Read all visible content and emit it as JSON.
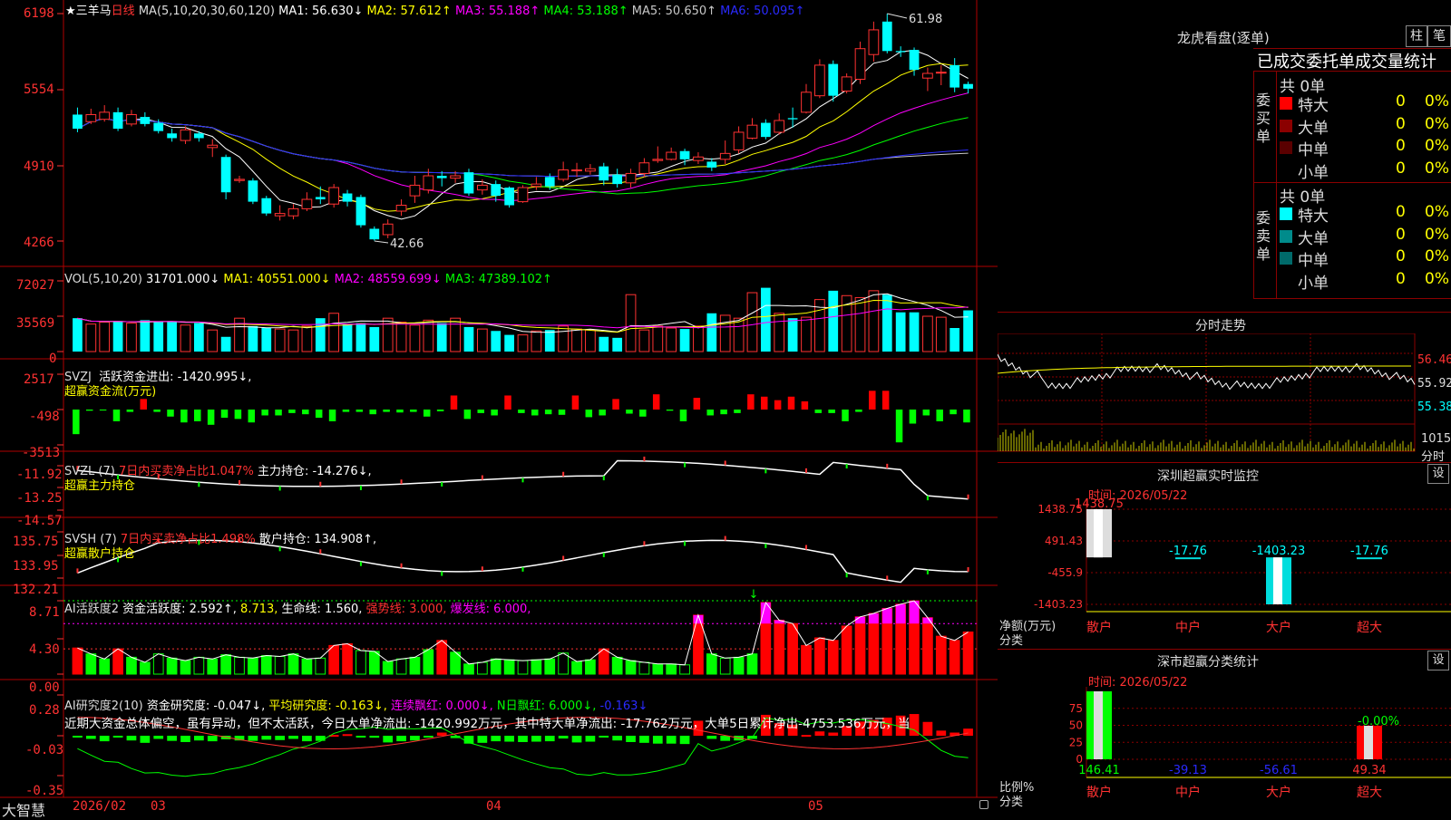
{
  "app_name": "大智慧",
  "kline": {
    "stock_name": "三羊马",
    "period": "日线",
    "ma_title": "MA(5,10,20,30,60,120)",
    "ma": [
      {
        "label": "MA1: 56.630↓",
        "color": "#ffffff"
      },
      {
        "label": "MA2: 57.612↑",
        "color": "#ffff00"
      },
      {
        "label": "MA3: 55.188↑",
        "color": "#ff00ff"
      },
      {
        "label": "MA4: 53.188↑",
        "color": "#00ff00"
      },
      {
        "label": "MA5: 50.650↑",
        "color": "#c8c8c8"
      },
      {
        "label": "MA6: 50.095↑",
        "color": "#2a2aff"
      }
    ],
    "y_ticks": [
      "6198",
      "5554",
      "4910",
      "4266"
    ],
    "high_label": "61.98",
    "low_label": "42.66",
    "candles": [
      {
        "o": 53.4,
        "c": 52.2,
        "h": 54.0,
        "l": 51.9
      },
      {
        "o": 52.8,
        "c": 53.4,
        "h": 53.9,
        "l": 52.6
      },
      {
        "o": 53.0,
        "c": 53.6,
        "h": 54.2,
        "l": 52.8
      },
      {
        "o": 53.6,
        "c": 52.2,
        "h": 54.0,
        "l": 52.0
      },
      {
        "o": 52.6,
        "c": 53.4,
        "h": 53.8,
        "l": 52.4
      },
      {
        "o": 53.2,
        "c": 52.6,
        "h": 53.6,
        "l": 52.4
      },
      {
        "o": 52.7,
        "c": 52.0,
        "h": 53.0,
        "l": 51.8
      },
      {
        "o": 51.8,
        "c": 51.4,
        "h": 52.2,
        "l": 51.1
      },
      {
        "o": 51.2,
        "c": 52.1,
        "h": 52.4,
        "l": 50.9
      },
      {
        "o": 51.8,
        "c": 51.4,
        "h": 52.0,
        "l": 51.1
      },
      {
        "o": 50.6,
        "c": 50.8,
        "h": 51.3,
        "l": 49.8
      },
      {
        "o": 49.8,
        "c": 46.8,
        "h": 50.0,
        "l": 46.2
      },
      {
        "o": 47.8,
        "c": 47.9,
        "h": 48.2,
        "l": 47.6
      },
      {
        "o": 47.8,
        "c": 46.0,
        "h": 48.0,
        "l": 45.8
      },
      {
        "o": 46.3,
        "c": 45.0,
        "h": 46.5,
        "l": 44.8
      },
      {
        "o": 44.8,
        "c": 45.0,
        "h": 45.7,
        "l": 44.4
      },
      {
        "o": 44.8,
        "c": 45.4,
        "h": 45.8,
        "l": 44.5
      },
      {
        "o": 45.4,
        "c": 46.2,
        "h": 46.8,
        "l": 45.2
      },
      {
        "o": 46.4,
        "c": 46.2,
        "h": 47.3,
        "l": 45.8
      },
      {
        "o": 45.8,
        "c": 47.2,
        "h": 47.5,
        "l": 45.5
      },
      {
        "o": 46.7,
        "c": 46.0,
        "h": 47.0,
        "l": 45.6
      },
      {
        "o": 46.4,
        "c": 44.0,
        "h": 46.6,
        "l": 43.8
      },
      {
        "o": 43.7,
        "c": 42.8,
        "h": 43.9,
        "l": 42.7
      },
      {
        "o": 43.2,
        "c": 44.1,
        "h": 44.5,
        "l": 42.9
      },
      {
        "o": 45.2,
        "c": 45.7,
        "h": 46.2,
        "l": 44.8
      },
      {
        "o": 46.5,
        "c": 47.4,
        "h": 48.2,
        "l": 45.9
      },
      {
        "o": 47.0,
        "c": 48.2,
        "h": 48.8,
        "l": 46.7
      },
      {
        "o": 48.2,
        "c": 48.0,
        "h": 48.6,
        "l": 47.3
      },
      {
        "o": 48.0,
        "c": 48.2,
        "h": 48.6,
        "l": 47.6
      },
      {
        "o": 48.5,
        "c": 46.7,
        "h": 48.8,
        "l": 46.5
      },
      {
        "o": 47.0,
        "c": 47.4,
        "h": 47.9,
        "l": 46.6
      },
      {
        "o": 47.5,
        "c": 46.5,
        "h": 47.8,
        "l": 46.0
      },
      {
        "o": 47.2,
        "c": 45.7,
        "h": 47.3,
        "l": 45.5
      },
      {
        "o": 46.0,
        "c": 47.2,
        "h": 47.4,
        "l": 45.9
      },
      {
        "o": 47.3,
        "c": 47.5,
        "h": 48.1,
        "l": 47.0
      },
      {
        "o": 48.1,
        "c": 47.3,
        "h": 48.4,
        "l": 47.0
      },
      {
        "o": 47.9,
        "c": 48.7,
        "h": 49.4,
        "l": 47.7
      },
      {
        "o": 48.7,
        "c": 48.7,
        "h": 49.3,
        "l": 48.1
      },
      {
        "o": 48.6,
        "c": 48.8,
        "h": 49.2,
        "l": 48.3
      },
      {
        "o": 49.0,
        "c": 47.8,
        "h": 49.3,
        "l": 47.4
      },
      {
        "o": 48.3,
        "c": 47.5,
        "h": 48.8,
        "l": 47.2
      },
      {
        "o": 47.6,
        "c": 48.4,
        "h": 48.8,
        "l": 47.2
      },
      {
        "o": 48.4,
        "c": 49.3,
        "h": 49.7,
        "l": 48.1
      },
      {
        "o": 49.5,
        "c": 49.6,
        "h": 50.7,
        "l": 49.3
      },
      {
        "o": 49.6,
        "c": 50.2,
        "h": 50.6,
        "l": 49.5
      },
      {
        "o": 50.3,
        "c": 49.6,
        "h": 50.5,
        "l": 49.1
      },
      {
        "o": 49.5,
        "c": 49.8,
        "h": 50.2,
        "l": 49.2
      },
      {
        "o": 49.4,
        "c": 48.9,
        "h": 49.7,
        "l": 48.6
      },
      {
        "o": 49.6,
        "c": 50.1,
        "h": 51.2,
        "l": 49.2
      },
      {
        "o": 50.4,
        "c": 51.9,
        "h": 52.4,
        "l": 50.1
      },
      {
        "o": 51.4,
        "c": 52.5,
        "h": 53.1,
        "l": 51.3
      },
      {
        "o": 52.7,
        "c": 51.5,
        "h": 53.0,
        "l": 51.3
      },
      {
        "o": 51.9,
        "c": 52.9,
        "h": 53.5,
        "l": 51.7
      },
      {
        "o": 53.1,
        "c": 53.0,
        "h": 54.0,
        "l": 52.3
      },
      {
        "o": 53.6,
        "c": 55.3,
        "h": 56.0,
        "l": 53.5
      },
      {
        "o": 55.0,
        "c": 57.6,
        "h": 58.1,
        "l": 54.8
      },
      {
        "o": 57.7,
        "c": 55.0,
        "h": 58.0,
        "l": 54.5
      },
      {
        "o": 55.4,
        "c": 56.6,
        "h": 56.9,
        "l": 55.2
      },
      {
        "o": 56.4,
        "c": 59.0,
        "h": 59.6,
        "l": 56.0
      },
      {
        "o": 58.5,
        "c": 60.6,
        "h": 61.3,
        "l": 57.9
      },
      {
        "o": 61.3,
        "c": 58.8,
        "h": 61.98,
        "l": 58.6
      },
      {
        "o": 58.8,
        "c": 58.7,
        "h": 59.2,
        "l": 58.3
      },
      {
        "o": 58.9,
        "c": 57.2,
        "h": 59.1,
        "l": 56.7
      },
      {
        "o": 56.5,
        "c": 56.9,
        "h": 57.4,
        "l": 55.4
      },
      {
        "o": 57.0,
        "c": 57.0,
        "h": 57.6,
        "l": 55.9
      },
      {
        "o": 57.6,
        "c": 55.7,
        "h": 58.2,
        "l": 55.3
      },
      {
        "o": 56.0,
        "c": 55.6,
        "h": 56.2,
        "l": 55.2
      }
    ]
  },
  "vol": {
    "title": "VOL(5,10,20)",
    "value": "31701.000↓",
    "ma1": "MA1: 40551.000↓",
    "ma2": "MA2: 48559.699↓",
    "ma3": "MA3: 47389.102↑",
    "y_ticks": [
      "72027",
      "35569",
      "0"
    ],
    "values": [
      34000,
      28000,
      30000,
      31000,
      29000,
      32000,
      30000,
      31000,
      27000,
      29000,
      22000,
      15000,
      34000,
      26000,
      24000,
      23000,
      22000,
      26000,
      34000,
      39000,
      28000,
      29000,
      25000,
      34000,
      30000,
      27000,
      32000,
      29000,
      34000,
      25000,
      23000,
      21000,
      17000,
      17000,
      21000,
      22000,
      26000,
      23000,
      22000,
      15000,
      14000,
      58000,
      22000,
      26000,
      24000,
      23000,
      26000,
      39000,
      37000,
      34000,
      60000,
      65000,
      39000,
      34000,
      35000,
      53000,
      62000,
      57000,
      55000,
      62000,
      58000,
      40000,
      40000,
      36000,
      35000,
      24000,
      42000
    ]
  },
  "svzj": {
    "title": "SVZJ",
    "value_label": "活跃资金进出: -1420.995↓,",
    "subtitle": "超赢资金流(万元)",
    "y_ticks": [
      "2517",
      "-498",
      "-3513"
    ],
    "values": [
      -2100,
      -100,
      -80,
      -1000,
      -200,
      900,
      -200,
      -600,
      -1100,
      -1000,
      -1300,
      -700,
      -800,
      -1100,
      -500,
      -500,
      -300,
      -400,
      -700,
      -1000,
      -200,
      -200,
      -400,
      -200,
      -250,
      -200,
      -600,
      -150,
      1200,
      -800,
      -300,
      -500,
      1200,
      -300,
      -500,
      -400,
      -450,
      1200,
      -650,
      -500,
      900,
      -350,
      -600,
      1300,
      -100,
      -1000,
      1000,
      -500,
      -400,
      -300,
      1300,
      1100,
      800,
      1100,
      700,
      -300,
      -300,
      -1000,
      -200,
      1600,
      1600,
      -2800,
      -1200,
      -500,
      -1000,
      -400,
      -1100
    ]
  },
  "svzl": {
    "title": "SVZL (7)",
    "ratio": "7日内买卖净占比1.047%",
    "hold": "主力持仓: -14.276↓,",
    "subtitle": "超赢主力持仓",
    "y_ticks": [
      "-11.92",
      "-13.25",
      "-14.57"
    ]
  },
  "svsh": {
    "title": "SVSH (7)",
    "ratio": "7日内买卖净占比1.498%",
    "hold": "散户持仓: 134.908↑,",
    "subtitle": "超赢散户持仓",
    "y_ticks": [
      "135.75",
      "133.95",
      "132.21"
    ]
  },
  "ai_active": {
    "title": "AI活跃度2",
    "fund_active": "资金活跃度: 2.592↑,",
    "v2": "8.713,",
    "life": "生命线: 1.560,",
    "strong": "强势线: 3.000,",
    "burst": "爆发线: 6.000,",
    "y_ticks": [
      "8.71",
      "4.30",
      "0.00"
    ],
    "values": [
      3.1,
      2.4,
      1.8,
      3.0,
      2.0,
      1.4,
      2.4,
      1.9,
      1.6,
      2.0,
      1.8,
      2.3,
      2.0,
      1.9,
      2.2,
      2.1,
      2.4,
      1.8,
      1.9,
      3.4,
      3.6,
      2.8,
      2.7,
      1.5,
      1.8,
      2.0,
      2.9,
      4.0,
      2.6,
      1.2,
      1.4,
      1.8,
      1.7,
      1.6,
      1.7,
      1.8,
      2.5,
      1.5,
      1.7,
      3.0,
      2.0,
      1.6,
      1.4,
      1.2,
      1.2,
      1.1,
      7.0,
      2.4,
      1.9,
      2.0,
      2.4,
      8.5,
      6.4,
      6.0,
      3.4,
      4.3,
      4.0,
      5.7,
      6.8,
      7.2,
      7.8,
      8.3,
      8.7,
      6.7,
      4.5,
      4.0,
      5.0,
      4.4,
      3.7,
      4.6,
      3.0
    ]
  },
  "ai_research": {
    "title": "AI研究度2(10)",
    "fund_research": "资金研究度: -0.047↓,",
    "avg": "平均研究度: -0.163↓,",
    "streak": "连续飘红: 0.000↓,",
    "nday": "N日飘红: 6.000↓,",
    "last": "-0.163↓",
    "comment": "近期大资金总体偏空，虽有异动，但不太活跃，今日大单净流出: -1420.992万元，其中特大单净流出: -17.762万元，大单5日累计净出-4753.536万元，当",
    "y_ticks": [
      "0.28",
      "-0.03",
      "-0.35"
    ]
  },
  "x_labels": [
    "2026/02",
    "03",
    "04",
    "05"
  ],
  "right": {
    "tabs": [
      "柱",
      "笔"
    ],
    "dragon_title": "龙虎看盘(逐单)",
    "order_header": "已成交委托单成交量统计",
    "buy": {
      "side_label": "委买单",
      "total": "共 0单",
      "rows": [
        {
          "name": "特大",
          "val": "0",
          "pct": "0%",
          "color": "#ff0000"
        },
        {
          "name": "大单",
          "val": "0",
          "pct": "0%",
          "color": "#8b0000"
        },
        {
          "name": "中单",
          "val": "0",
          "pct": "0%",
          "color": "#5a0000"
        },
        {
          "name": "小单",
          "val": "0",
          "pct": "0%",
          "color": "#000000"
        }
      ]
    },
    "sell": {
      "side_label": "委卖单",
      "total": "共 0单",
      "rows": [
        {
          "name": "特大",
          "val": "0",
          "pct": "0%",
          "color": "#00ffff"
        },
        {
          "name": "大单",
          "val": "0",
          "pct": "0%",
          "color": "#008b8b"
        },
        {
          "name": "中单",
          "val": "0",
          "pct": "0%",
          "color": "#006a6a"
        },
        {
          "name": "小单",
          "val": "0",
          "pct": "0%",
          "color": "#000000"
        }
      ]
    },
    "intraday": {
      "title": "分时走势",
      "y_labels": [
        "56.46",
        "55.92",
        "55.38"
      ],
      "vol_labels": [
        "1015",
        "分时"
      ]
    },
    "monitor": {
      "title": "深圳超赢实时监控",
      "settings": "设",
      "time": "时间: 2026/05/22",
      "y_ticks": [
        "1438.75",
        "491.43",
        "-455.9",
        "-1403.23"
      ],
      "unit": "净额(万元)",
      "axis_label": "分类",
      "categories": [
        "散户",
        "中户",
        "大户",
        "超大"
      ],
      "values": [
        1438.75,
        -17.76,
        -1403.23,
        -17.76
      ],
      "value_labels": [
        "1438.75",
        "-17.76",
        "-1403.23",
        "-17.76"
      ]
    },
    "stats": {
      "title": "深市超赢分类统计",
      "settings": "设",
      "time": "时间: 2026/05/22",
      "y_ticks": [
        "75",
        "50",
        "25",
        "0"
      ],
      "unit": "比例%",
      "axis_label": "分类",
      "categories": [
        "散户",
        "中户",
        "大户",
        "超大"
      ],
      "values": [
        146.41,
        -39.13,
        -56.61,
        49.34
      ],
      "value_labels": [
        "146.41",
        "-39.13",
        "-56.61",
        "49.34"
      ],
      "top_label": "-0.00%"
    }
  }
}
